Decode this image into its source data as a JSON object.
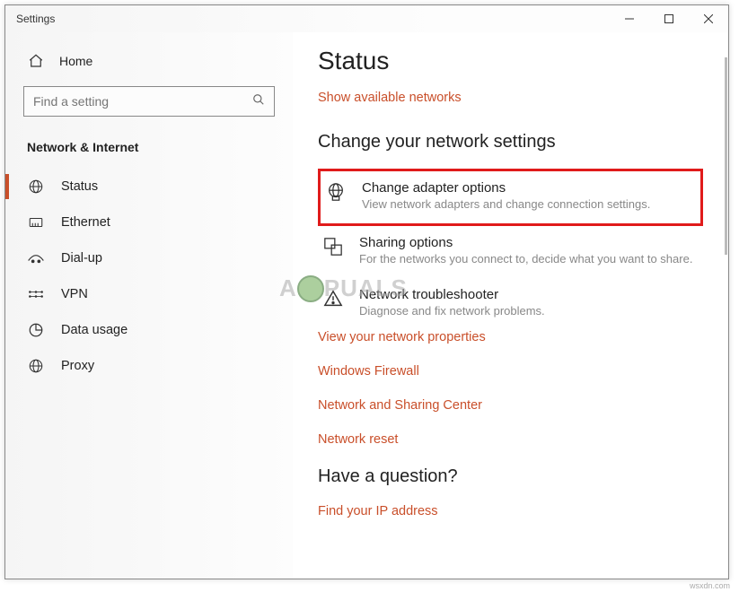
{
  "window": {
    "title": "Settings"
  },
  "sidebar": {
    "home": "Home",
    "search_placeholder": "Find a setting",
    "category": "Network & Internet",
    "items": [
      {
        "label": "Status"
      },
      {
        "label": "Ethernet"
      },
      {
        "label": "Dial-up"
      },
      {
        "label": "VPN"
      },
      {
        "label": "Data usage"
      },
      {
        "label": "Proxy"
      }
    ]
  },
  "main": {
    "title": "Status",
    "show_networks": "Show available networks",
    "change_header": "Change your network settings",
    "options": [
      {
        "title": "Change adapter options",
        "desc": "View network adapters and change connection settings."
      },
      {
        "title": "Sharing options",
        "desc": "For the networks you connect to, decide what you want to share."
      },
      {
        "title": "Network troubleshooter",
        "desc": "Diagnose and fix network problems."
      }
    ],
    "links": [
      "View your network properties",
      "Windows Firewall",
      "Network and Sharing Center",
      "Network reset"
    ],
    "question_header": "Have a question?",
    "question_link": "Find your IP address"
  },
  "watermark": {
    "left": "A",
    "right": "PUALS"
  },
  "footer": "wsxdn.com"
}
